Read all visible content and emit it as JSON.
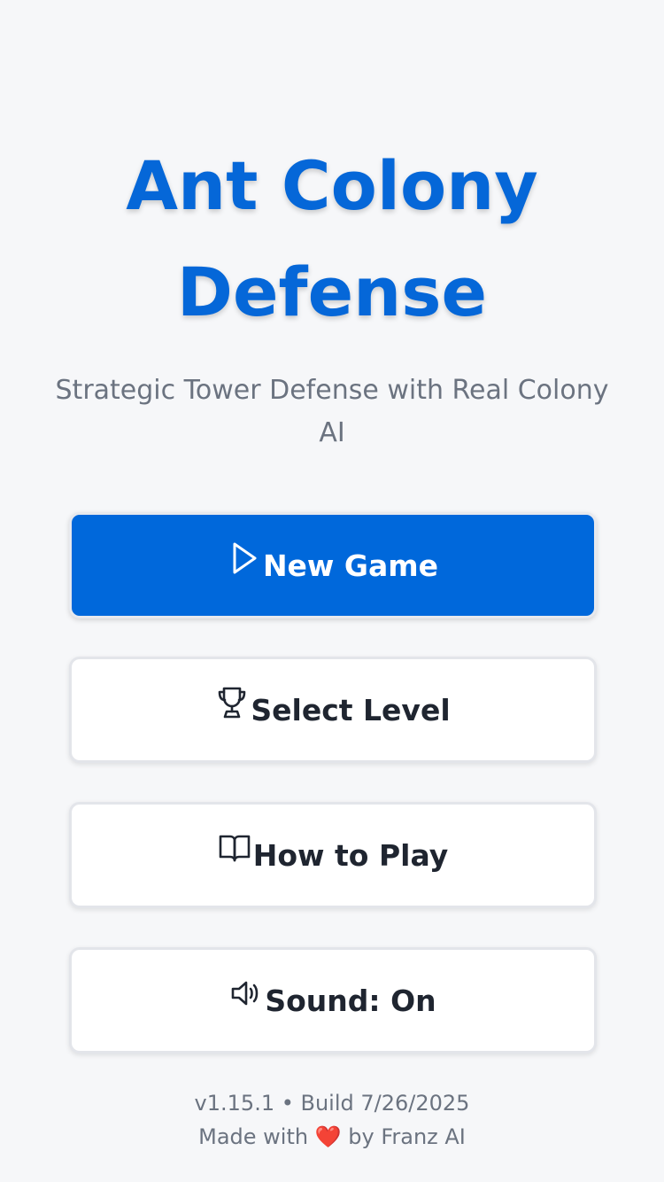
{
  "title": {
    "line1": "Ant Colony",
    "line2": "Defense"
  },
  "subtitle": "Strategic Tower Defense with Real Colony AI",
  "menu": {
    "new_game": {
      "label": "New Game",
      "icon": "play-icon"
    },
    "select_level": {
      "label": "Select Level",
      "icon": "trophy-icon"
    },
    "how_to_play": {
      "label": "How to Play",
      "icon": "book-icon"
    },
    "sound": {
      "label": "Sound: On",
      "icon": "speaker-icon"
    }
  },
  "footer": {
    "version": "v1.15.1 • Build 7/26/2025",
    "credit_prefix": "Made with",
    "heart": "❤️",
    "credit_suffix": "by Franz AI"
  },
  "colors": {
    "background": "#f6f7f9",
    "accent": "#0567d8",
    "primary_button": "#0068db",
    "text_muted": "#6b7380",
    "text_dark": "#1f2530",
    "heart": "#e02424"
  }
}
